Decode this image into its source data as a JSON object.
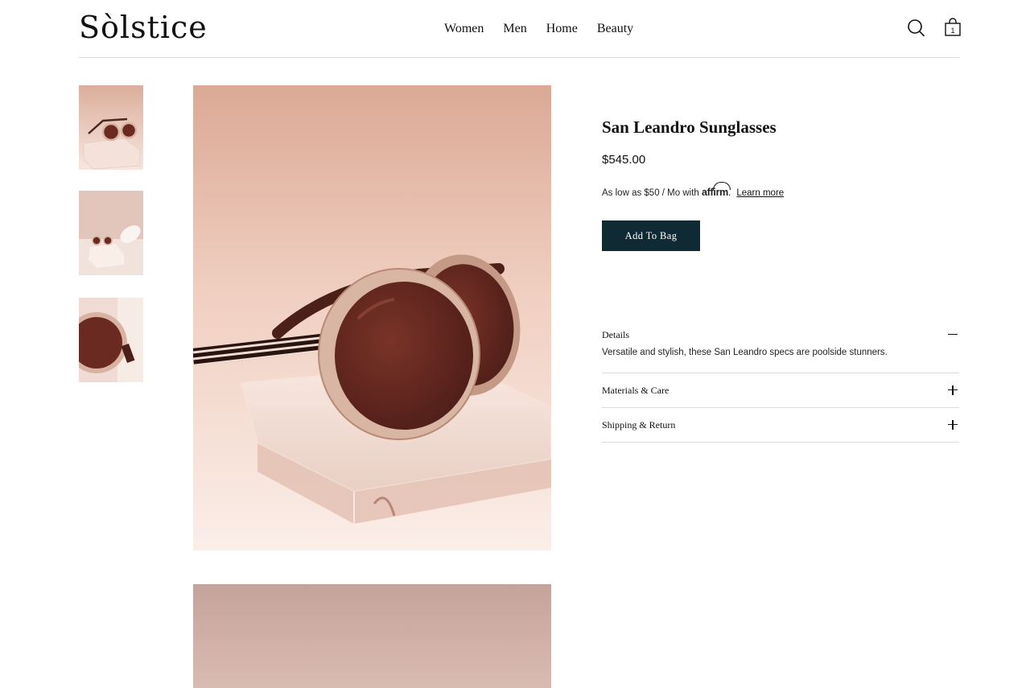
{
  "header": {
    "logo": "Sòlstice",
    "nav": [
      "Women",
      "Men",
      "Home",
      "Beauty"
    ],
    "cart_count": "1",
    "icons": {
      "search": "search-icon",
      "bag": "shopping-bag-icon"
    }
  },
  "product": {
    "title": "San Leandro Sunglasses",
    "price": "$545.00",
    "financing": {
      "prefix": "As low as $50 / Mo with",
      "provider": "affirm",
      "suffix": ".",
      "learn_more": "Learn more"
    },
    "add_to_bag": "Add To Bag"
  },
  "accordion": [
    {
      "title": "Details",
      "expanded": true,
      "body": "Versatile and stylish, these San Leandro specs are poolside stunners."
    },
    {
      "title": "Materials & Care",
      "expanded": false
    },
    {
      "title": "Shipping & Return",
      "expanded": false
    }
  ],
  "colors": {
    "button_bg": "#0f2a33",
    "image_peach": "#e8c2b2",
    "lens_brown": "#6a2a22"
  }
}
